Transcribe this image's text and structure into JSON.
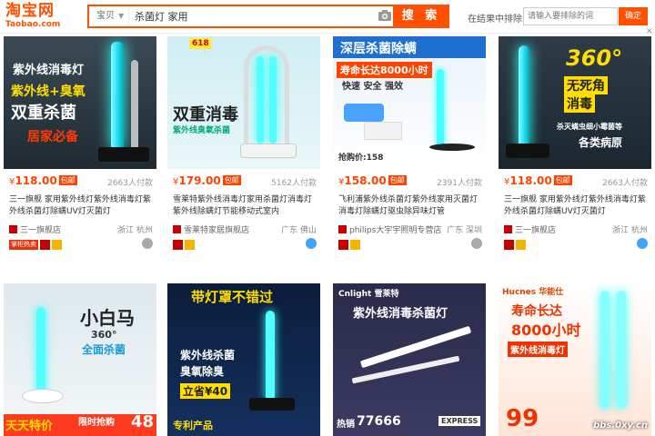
{
  "header": {
    "logo_cn": "淘宝网",
    "logo_en": "Taobao.com",
    "scope": "宝贝",
    "query": "杀菌灯 家用",
    "search_button": "搜 索",
    "exclude_label": "在结果中排除",
    "exclude_placeholder": "请输入要排除的词",
    "exclude_button": "确定"
  },
  "products": [
    {
      "price": "118.00",
      "yen": "¥",
      "baoyou": "包邮",
      "sold": "2663人付款",
      "title_a": "三一旗舰 家用紫外线灯紫外线消毒灯紫外线杀菌灯除螨UV灯灭菌灯",
      "shop": "三一旗舰店",
      "loc": "浙江 杭州",
      "overlay": [
        "紫外线消毒灯",
        "紫外线+臭氧",
        "双重杀菌",
        "居家必备"
      ],
      "tag": "掌柜热卖"
    },
    {
      "price": "179.00",
      "yen": "¥",
      "baoyou": "包邮",
      "sold": "5162人付款",
      "title_a": "雪莱特紫外线消毒灯家用杀菌灯消毒灯紫外线除螨灯节能移动式室内",
      "shop": "雪莱特家居旗舰店",
      "loc": "广东 佛山",
      "overlay": [
        "618",
        "双重消毒",
        "紫外线臭氧杀菌"
      ]
    },
    {
      "price": "158.00",
      "yen": "¥",
      "baoyou": "包邮",
      "sold": "2391人付款",
      "title_a": "飞利浦紫外线杀菌灯紫外线家用灭菌灯消毒灯除螨灯驱虫除异味灯管",
      "shop": "philips大宇宇照明专营店",
      "loc": "广东 深圳",
      "overlay": [
        "深层杀菌除螨",
        "寿命长达8000小时",
        "快速 安全 强效",
        "抢购价:158"
      ]
    },
    {
      "price": "118.00",
      "yen": "¥",
      "baoyou": "包邮",
      "sold": "2663人付款",
      "title_a": "三一旗舰 家用紫外线灯紫外线消毒灯紫外线杀菌灯除螨UV灯灭菌灯",
      "shop": "三一旗舰店",
      "loc": "浙江 杭州",
      "overlay": [
        "360°",
        "无死角",
        "消毒",
        "杀灭螨虫细小霉菌等",
        "各类病原"
      ]
    },
    {
      "overlay": [
        "小白马",
        "360°",
        "全面杀菌",
        "天天特价",
        "限时抢购",
        "48"
      ]
    },
    {
      "overlay": [
        "带灯罩不错过",
        "紫外线杀菌",
        "臭氧除臭",
        "立省¥40",
        "专利产品"
      ]
    },
    {
      "overlay": [
        "Cnlight 雪莱特",
        "紫外线消毒杀菌灯",
        "热销",
        "77666",
        "EXPRESS"
      ]
    },
    {
      "overlay": [
        "Hucnes 华能仕",
        "寿命长达",
        "8000小时",
        "紫外线消毒灯",
        "99"
      ]
    }
  ],
  "watermark": "bbs.0xy.cn",
  "colors": {
    "brand": "#ff5000",
    "price": "#ff4400",
    "lamp_glow": "#35e6ff"
  }
}
